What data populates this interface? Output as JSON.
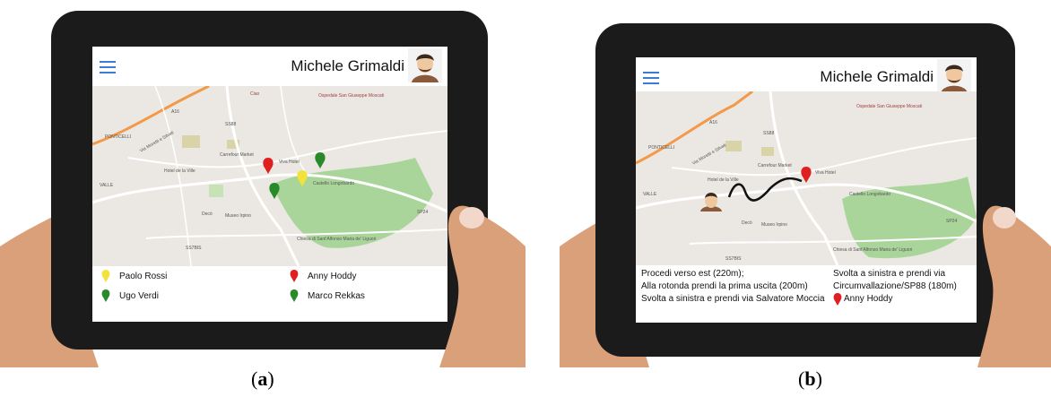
{
  "captions": {
    "a": "a",
    "b": "b"
  },
  "panel_a": {
    "user_name": "Michele Grimaldi",
    "map_labels": {
      "ponticelli": "PONTICELLI",
      "valle": "VALLE",
      "via_moretti": "Via Moretti e Silvati",
      "hotel": "Hotel de la Ville",
      "carrefour": "Carrefour Market",
      "viva_hotel": "Viva Hotel",
      "castello": "Castello Longobardo",
      "ospedale": "Ospedale San Giuseppe Moscati",
      "chiesa": "Chiesa di Sant'Alfonso Maria de' Liguori",
      "museo": "Museo Irpino",
      "deco": "Decò",
      "ciao": "Ciao",
      "a16": "A16",
      "ss88": "SS88",
      "ss7bis": "SS7BIS",
      "sp24": "SP24"
    },
    "legend": [
      {
        "name": "Paolo Rossi",
        "color": "#f2e23c"
      },
      {
        "name": "Anny Hoddy",
        "color": "#e02020"
      },
      {
        "name": "Ugo Verdi",
        "color": "#2a8a2a"
      },
      {
        "name": "Marco Rekkas",
        "color": "#2a8a2a"
      }
    ]
  },
  "panel_b": {
    "user_name": "Michele Grimaldi",
    "directions_left": [
      "Procedi verso est (220m);",
      "Alla rotonda prendi la prima uscita (200m)",
      "Svolta a sinistra e prendi via Salvatore Moccia"
    ],
    "directions_right": [
      "Svolta a sinistra e prendi via",
      "Circumvallazione/SP88 (180m)"
    ],
    "destination": {
      "name": "Anny Hoddy",
      "color": "#e02020"
    }
  },
  "colors": {
    "accent_blue": "#3a7bd5",
    "tablet_frame": "#1b1b1b",
    "map_bg": "#ebe8e3",
    "park_green": "#a9d59a",
    "highway_orange": "#f29a4a"
  }
}
